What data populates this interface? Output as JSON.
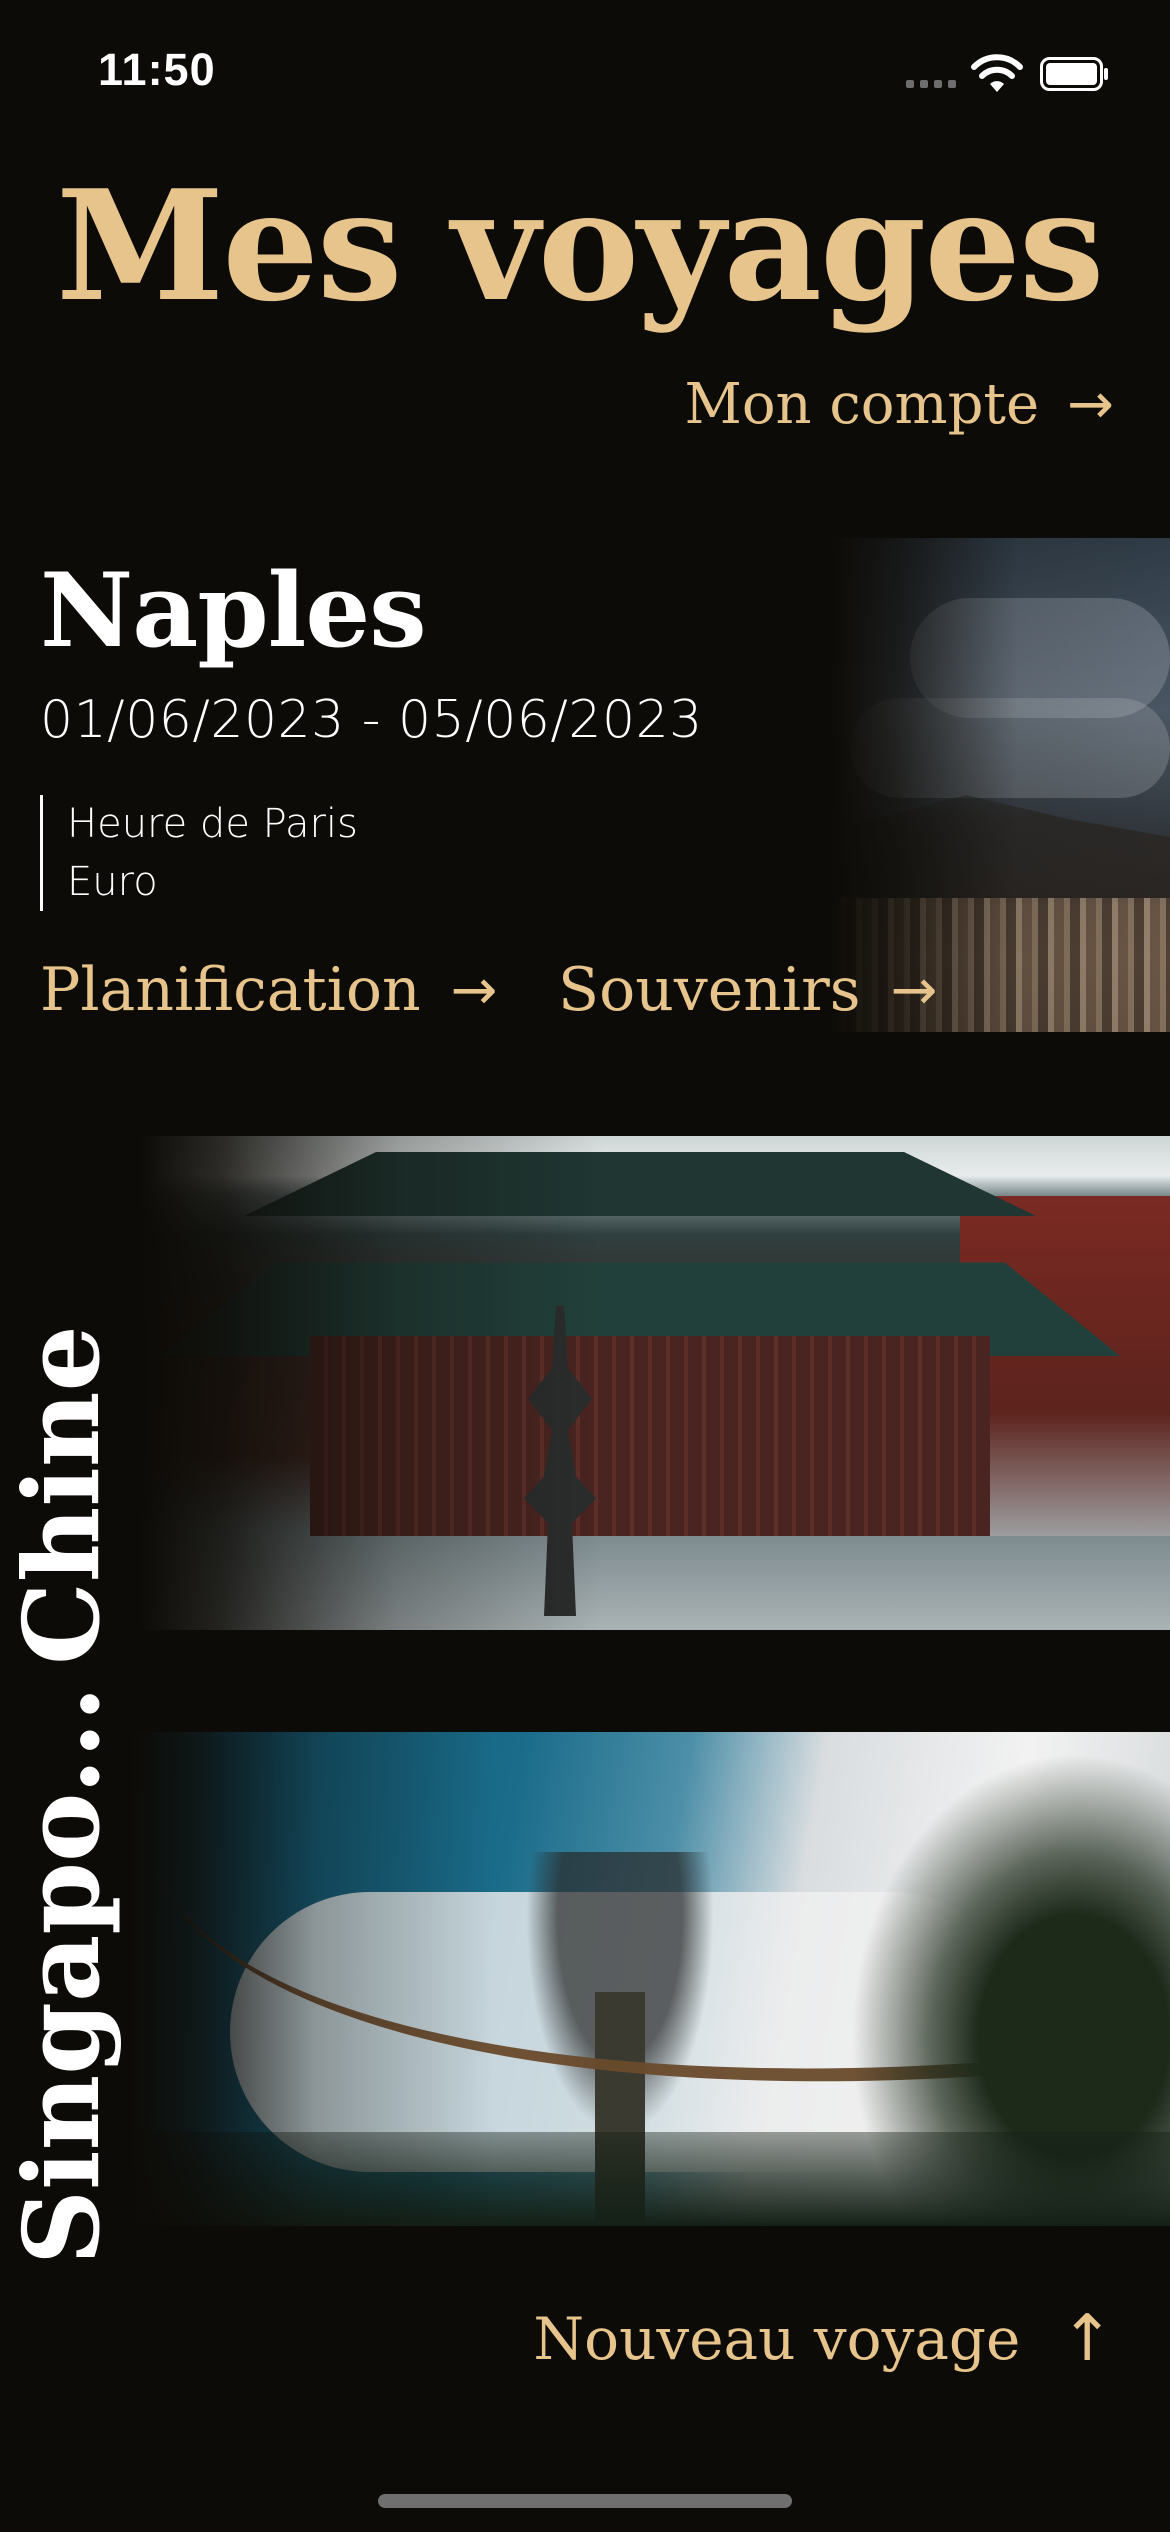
{
  "status_bar": {
    "time": "11:50"
  },
  "header": {
    "title": "Mes voyages",
    "account_link": "Mon compte",
    "account_arrow": "→"
  },
  "trips": [
    {
      "name": "Naples",
      "dates": "01/06/2023 - 05/06/2023",
      "timezone": "Heure de Paris",
      "currency": "Euro",
      "planning_label": "Planification",
      "souvenirs_label": "Souvenirs",
      "arrow": "→",
      "image_icon": "photo-naples"
    },
    {
      "name": "Chine",
      "image_icon": "photo-temple"
    },
    {
      "name": "Singapo...",
      "image_icon": "photo-gardens"
    }
  ],
  "footer": {
    "new_trip_label": "Nouveau voyage",
    "new_trip_arrow": "↑"
  },
  "colors": {
    "background": "#0d0b07",
    "accent_gold": "#e6c48c",
    "text": "#ffffff"
  }
}
